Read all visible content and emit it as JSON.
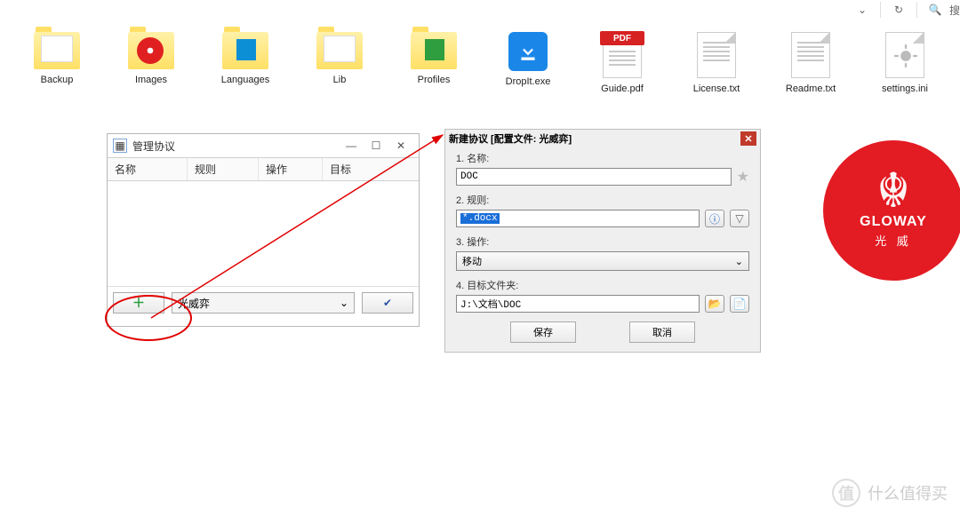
{
  "toolbar": {
    "search_label": "搜"
  },
  "folders": [
    {
      "label": "Backup",
      "kind": "folder-paper"
    },
    {
      "label": "Images",
      "kind": "folder-cd"
    },
    {
      "label": "Languages",
      "kind": "folder-sq-blue"
    },
    {
      "label": "Lib",
      "kind": "folder-paper"
    },
    {
      "label": "Profiles",
      "kind": "folder-sq-green"
    },
    {
      "label": "DropIt.exe",
      "kind": "exec"
    },
    {
      "label": "Guide.pdf",
      "kind": "pdf",
      "pdf_badge": "PDF"
    },
    {
      "label": "License.txt",
      "kind": "txt"
    },
    {
      "label": "Readme.txt",
      "kind": "txt"
    },
    {
      "label": "settings.ini",
      "kind": "ini"
    }
  ],
  "manage": {
    "title": "管理协议",
    "cols": {
      "name": "名称",
      "rule": "规则",
      "action": "操作",
      "target": "目标"
    },
    "profile_selected": "光威弈",
    "add_icon": "＋",
    "ok_icon": "✔"
  },
  "newrule": {
    "title": "新建协议 [配置文件: 光威弈]",
    "l1": "1. 名称:",
    "v1": "DOC",
    "l2": "2. 规则:",
    "v2": "*.docx",
    "l3": "3. 操作:",
    "v3": "移动",
    "l4": "4. 目标文件夹:",
    "v4": "J:\\文档\\DOC",
    "save": "保存",
    "cancel": "取消"
  },
  "brand": {
    "en": "GLOWAY",
    "cn": "光 威"
  },
  "watermark": {
    "char": "值",
    "text": "什么值得买"
  }
}
